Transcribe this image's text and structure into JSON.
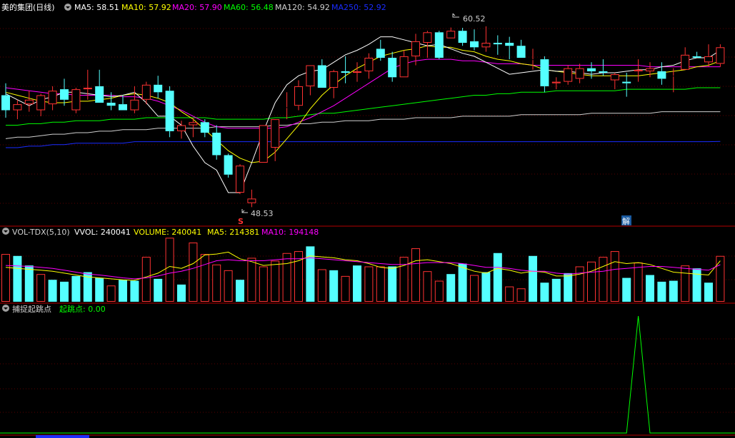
{
  "colors": {
    "bg": "#000000",
    "up": "#ff3232",
    "down": "#54ffff",
    "grid": "#5a0000",
    "divider": "#b40000",
    "ma5": "#ffffff",
    "ma10": "#ffff00",
    "ma20": "#ff00ff",
    "ma60": "#00ff00",
    "ma120": "#d0d0d0",
    "ma250": "#1a2cff",
    "signal": "#00ff00"
  },
  "main_panel": {
    "title": "美的集团(日线)",
    "ma5_label": "MA5: 58.51",
    "ma10_label": "MA10: 57.92",
    "ma20_label": "MA20: 57.90",
    "ma60_label": "MA60: 56.48",
    "ma120_label": "MA120: 54.92",
    "ma250_label": "MA250: 52.92",
    "high_marker": "60.52",
    "low_marker": "48.53",
    "s_marker": "S",
    "jie_marker": "解"
  },
  "volume_panel": {
    "title": "VOL-TDX(5,10)",
    "vvol_label": "VVOL: 240041",
    "volume_label": "VOLUME: 240041",
    "ma5_label": "MA5: 214381",
    "ma10_label": "MA10: 194148"
  },
  "signal_panel": {
    "title": "捕捉起跳点",
    "value_label": "起跳点: 0.00"
  },
  "chart_data": [
    {
      "type": "candlestick",
      "title": "美的集团(日线)",
      "ylim": [
        47.5,
        61.5
      ],
      "ohlc": [
        [
          56.0,
          56.8,
          54.5,
          55.0
        ],
        [
          55.0,
          55.7,
          54.4,
          55.4
        ],
        [
          55.4,
          56.3,
          54.9,
          55.7
        ],
        [
          55.0,
          56.1,
          54.6,
          56.0
        ],
        [
          55.4,
          56.6,
          55.0,
          56.3
        ],
        [
          56.4,
          57.1,
          55.3,
          55.7
        ],
        [
          55.0,
          56.5,
          54.8,
          56.4
        ],
        [
          56.4,
          57.7,
          55.7,
          56.5
        ],
        [
          56.6,
          57.7,
          55.6,
          55.5
        ],
        [
          55.5,
          56.2,
          55.0,
          55.3
        ],
        [
          55.4,
          56.0,
          55.0,
          55.0
        ],
        [
          55.0,
          56.6,
          54.8,
          55.7
        ],
        [
          55.7,
          56.9,
          55.4,
          56.7
        ],
        [
          56.7,
          57.3,
          55.8,
          56.2
        ],
        [
          56.3,
          56.6,
          53.2,
          53.6
        ],
        [
          53.6,
          54.3,
          53.1,
          54.0
        ],
        [
          54.0,
          54.5,
          53.2,
          54.2
        ],
        [
          54.2,
          54.4,
          53.2,
          53.5
        ],
        [
          53.5,
          54.0,
          51.7,
          52.0
        ],
        [
          52.0,
          52.1,
          50.5,
          50.7
        ],
        [
          49.5,
          51.4,
          49.4,
          51.3
        ],
        [
          48.8,
          49.7,
          48.53,
          49.1
        ],
        [
          51.5,
          54.0,
          51.5,
          54.0
        ],
        [
          52.5,
          54.3,
          51.6,
          54.4
        ],
        [
          55.2,
          56.2,
          54.4,
          55.2
        ],
        [
          55.3,
          57.0,
          55.0,
          56.6
        ],
        [
          56.6,
          57.6,
          56.0,
          58.0
        ],
        [
          58.0,
          58.4,
          56.6,
          56.5
        ],
        [
          56.5,
          57.7,
          55.8,
          57.6
        ],
        [
          57.6,
          58.6,
          56.8,
          57.5
        ],
        [
          57.5,
          58.2,
          56.9,
          57.6
        ],
        [
          57.6,
          58.8,
          57.1,
          58.5
        ],
        [
          59.1,
          59.7,
          58.3,
          58.5
        ],
        [
          58.5,
          58.9,
          56.9,
          57.2
        ],
        [
          57.2,
          59.0,
          57.2,
          58.6
        ],
        [
          58.6,
          60.1,
          58.0,
          59.6
        ],
        [
          59.5,
          60.3,
          58.5,
          60.2
        ],
        [
          60.2,
          60.3,
          58.4,
          58.5
        ],
        [
          59.8,
          60.52,
          59.8,
          60.3
        ],
        [
          60.3,
          60.5,
          59.3,
          59.5
        ],
        [
          59.6,
          60.4,
          59.0,
          59.2
        ],
        [
          59.2,
          60.6,
          58.9,
          59.5
        ],
        [
          59.5,
          60.0,
          58.7,
          59.4
        ],
        [
          59.5,
          59.9,
          58.4,
          59.3
        ],
        [
          59.3,
          59.7,
          58.6,
          58.5
        ],
        [
          58.4,
          59.1,
          57.7,
          58.4
        ],
        [
          58.4,
          58.6,
          56.2,
          56.6
        ],
        [
          56.8,
          57.2,
          56.4,
          56.9
        ],
        [
          56.9,
          58.0,
          56.7,
          57.8
        ],
        [
          57.1,
          58.1,
          56.8,
          57.8
        ],
        [
          57.8,
          58.2,
          57.1,
          57.6
        ],
        [
          57.6,
          58.4,
          57.3,
          57.5
        ],
        [
          57.0,
          57.5,
          56.4,
          57.4
        ],
        [
          56.9,
          57.5,
          55.9,
          56.8
        ],
        [
          57.6,
          58.4,
          56.9,
          57.7
        ],
        [
          57.6,
          58.2,
          57.2,
          57.8
        ],
        [
          57.6,
          58.2,
          56.7,
          57.1
        ],
        [
          57.3,
          57.8,
          56.2,
          57.3
        ],
        [
          57.7,
          59.2,
          57.7,
          58.7
        ],
        [
          58.6,
          58.9,
          58.5,
          58.5
        ],
        [
          58.2,
          59.4,
          57.9,
          58.6
        ],
        [
          58.1,
          59.4,
          57.9,
          59.2
        ]
      ],
      "series": [
        {
          "name": "MA5",
          "values": [
            56.1,
            55.7,
            55.3,
            55.7,
            55.9,
            56.2,
            56.2,
            56.1,
            56.0,
            55.9,
            56.0,
            56.2,
            55.5,
            54.6,
            54.6,
            54.0,
            52.6,
            51.5,
            51.0,
            49.5,
            49.5,
            51.5,
            53.6,
            55.5,
            56.7,
            57.3,
            57.6,
            57.7,
            58.2,
            58.7,
            59.0,
            59.4,
            59.9,
            59.9,
            59.7,
            59.5,
            59.3,
            59.4,
            59.1,
            58.8,
            58.6,
            58.2,
            57.8,
            57.4,
            57.5,
            57.6,
            57.7,
            57.6,
            57.6,
            57.5,
            57.4,
            57.5,
            57.5,
            57.6,
            57.7,
            57.7,
            57.9,
            58.0,
            58.3,
            58.5,
            58.5,
            59.0
          ]
        },
        {
          "name": "MA10",
          "values": [
            56.2,
            56.0,
            55.8,
            55.6,
            55.5,
            55.5,
            55.6,
            55.6,
            55.7,
            55.8,
            56.0,
            56.1,
            56.0,
            55.8,
            55.5,
            54.9,
            54.4,
            53.7,
            53.0,
            52.3,
            51.8,
            51.5,
            51.6,
            52.2,
            53.1,
            54.0,
            55.1,
            56.0,
            56.7,
            57.3,
            57.8,
            58.2,
            58.6,
            58.8,
            59.0,
            59.1,
            59.3,
            59.2,
            59.2,
            59.0,
            58.9,
            58.6,
            58.4,
            58.3,
            58.1,
            58.0,
            57.7,
            57.6,
            57.5,
            57.4,
            57.3,
            57.3,
            57.3,
            57.3,
            57.3,
            57.4,
            57.5,
            57.6,
            57.7,
            57.9,
            58.0,
            58.3
          ]
        },
        {
          "name": "MA20",
          "values": [
            56.5,
            56.4,
            56.3,
            56.2,
            56.1,
            56.1,
            56.0,
            56.0,
            56.0,
            56.0,
            55.9,
            55.9,
            55.8,
            55.6,
            55.3,
            55.0,
            54.6,
            54.2,
            53.9,
            53.8,
            53.8,
            53.8,
            53.8,
            53.8,
            53.9,
            54.2,
            54.5,
            54.9,
            55.3,
            55.8,
            56.3,
            56.8,
            57.3,
            57.8,
            58.1,
            58.3,
            58.4,
            58.4,
            58.4,
            58.3,
            58.3,
            58.2,
            58.1,
            58.1,
            58.1,
            58.0,
            58.0,
            58.0,
            58.0,
            58.0,
            58.0,
            58.0,
            58.0,
            58.0,
            58.0,
            57.9,
            57.9,
            57.9,
            57.9,
            57.9,
            57.9,
            57.9
          ]
        },
        {
          "name": "MA60",
          "values": [
            54.0,
            54.0,
            54.1,
            54.1,
            54.2,
            54.2,
            54.3,
            54.3,
            54.3,
            54.4,
            54.4,
            54.4,
            54.5,
            54.5,
            54.5,
            54.5,
            54.5,
            54.5,
            54.4,
            54.4,
            54.4,
            54.4,
            54.4,
            54.5,
            54.5,
            54.6,
            54.7,
            54.8,
            54.8,
            54.9,
            55.0,
            55.1,
            55.2,
            55.3,
            55.4,
            55.5,
            55.6,
            55.7,
            55.8,
            55.9,
            56.0,
            56.0,
            56.1,
            56.1,
            56.2,
            56.2,
            56.2,
            56.3,
            56.3,
            56.3,
            56.3,
            56.3,
            56.3,
            56.4,
            56.4,
            56.4,
            56.4,
            56.4,
            56.4,
            56.5,
            56.5,
            56.5
          ]
        },
        {
          "name": "MA120",
          "values": [
            53.1,
            53.2,
            53.2,
            53.3,
            53.4,
            53.4,
            53.5,
            53.5,
            53.6,
            53.6,
            53.7,
            53.7,
            53.7,
            53.8,
            53.8,
            53.8,
            53.8,
            53.8,
            53.9,
            53.9,
            53.9,
            53.9,
            53.9,
            54.0,
            54.0,
            54.1,
            54.1,
            54.2,
            54.2,
            54.3,
            54.3,
            54.3,
            54.4,
            54.4,
            54.4,
            54.5,
            54.5,
            54.5,
            54.5,
            54.6,
            54.6,
            54.6,
            54.6,
            54.6,
            54.7,
            54.7,
            54.7,
            54.7,
            54.7,
            54.7,
            54.8,
            54.8,
            54.8,
            54.8,
            54.8,
            54.8,
            54.9,
            54.9,
            54.9,
            54.9,
            54.9,
            54.9
          ]
        },
        {
          "name": "MA250",
          "values": [
            52.5,
            52.5,
            52.6,
            52.6,
            52.7,
            52.7,
            52.8,
            52.8,
            52.8,
            52.8,
            52.8,
            52.9,
            52.9,
            52.9,
            52.9,
            52.9,
            52.9,
            52.9,
            52.9,
            52.9,
            52.9,
            52.9,
            52.9,
            52.9,
            52.9,
            52.9,
            52.9,
            52.9,
            52.9,
            52.9,
            52.9,
            52.9,
            52.9,
            52.9,
            52.9,
            52.9,
            52.9,
            52.9,
            52.9,
            52.9,
            52.9,
            52.9,
            52.9,
            52.9,
            52.9,
            52.9,
            52.9,
            52.9,
            52.9,
            52.9,
            52.9,
            52.9,
            52.9,
            52.9,
            52.9,
            52.9,
            52.9,
            52.9,
            52.9,
            52.9,
            52.9,
            52.92
          ]
        }
      ]
    },
    {
      "type": "bar",
      "title": "VOL-TDX(5,10)",
      "ylim": [
        0,
        340000
      ],
      "values": [
        250000,
        240000,
        190000,
        145000,
        115000,
        105000,
        135000,
        155000,
        125000,
        85000,
        115000,
        110000,
        235000,
        120000,
        335000,
        90000,
        310000,
        250000,
        195000,
        165000,
        115000,
        230000,
        185000,
        215000,
        255000,
        265000,
        290000,
        170000,
        165000,
        135000,
        190000,
        185000,
        185000,
        185000,
        235000,
        280000,
        160000,
        110000,
        145000,
        200000,
        140000,
        155000,
        255000,
        80000,
        70000,
        240000,
        100000,
        120000,
        150000,
        185000,
        210000,
        235000,
        265000,
        125000,
        205000,
        140000,
        105000,
        110000,
        190000,
        175000,
        100000,
        240041
      ],
      "up": [
        1,
        0,
        0,
        1,
        0,
        0,
        0,
        0,
        0,
        1,
        0,
        0,
        1,
        0,
        1,
        0,
        1,
        1,
        1,
        1,
        0,
        1,
        1,
        1,
        1,
        1,
        0,
        1,
        0,
        1,
        0,
        1,
        1,
        0,
        1,
        1,
        1,
        1,
        0,
        0,
        1,
        0,
        0,
        1,
        1,
        0,
        0,
        0,
        0,
        1,
        1,
        1,
        1,
        0,
        1,
        0,
        0,
        0,
        1,
        0,
        0,
        1
      ],
      "series": [
        {
          "name": "MA5",
          "values": [
            180000,
            175000,
            170000,
            165000,
            160000,
            150000,
            140000,
            130000,
            125000,
            120000,
            115000,
            112000,
            130000,
            150000,
            185000,
            175000,
            200000,
            245000,
            250000,
            260000,
            225000,
            210000,
            190000,
            195000,
            200000,
            215000,
            240000,
            235000,
            230000,
            220000,
            215000,
            200000,
            180000,
            175000,
            190000,
            215000,
            220000,
            210000,
            200000,
            180000,
            160000,
            150000,
            175000,
            165000,
            150000,
            160000,
            155000,
            135000,
            135000,
            145000,
            160000,
            185000,
            210000,
            200000,
            205000,
            195000,
            175000,
            155000,
            150000,
            145000,
            140000,
            214381
          ]
        },
        {
          "name": "MA10",
          "values": [
            190000,
            188000,
            185000,
            180000,
            175000,
            165000,
            155000,
            145000,
            140000,
            133000,
            125000,
            120000,
            125000,
            135000,
            150000,
            160000,
            175000,
            195000,
            215000,
            220000,
            215000,
            215000,
            215000,
            220000,
            225000,
            225000,
            230000,
            225000,
            220000,
            215000,
            210000,
            205000,
            200000,
            195000,
            195000,
            200000,
            205000,
            205000,
            205000,
            200000,
            190000,
            180000,
            180000,
            175000,
            165000,
            160000,
            160000,
            150000,
            145000,
            150000,
            155000,
            160000,
            170000,
            175000,
            180000,
            185000,
            185000,
            180000,
            175000,
            170000,
            165000,
            194148
          ]
        }
      ]
    },
    {
      "type": "line",
      "title": "捕捉起跳点",
      "ylim": [
        0,
        1
      ],
      "series": [
        {
          "name": "起跳点",
          "values": [
            0,
            0,
            0,
            0,
            0,
            0,
            0,
            0,
            0,
            0,
            0,
            0,
            0,
            0,
            0,
            0,
            0,
            0,
            0,
            0,
            0,
            0,
            0,
            0,
            0,
            0,
            0,
            0,
            0,
            0,
            0,
            0,
            0,
            0,
            0,
            0,
            0,
            0,
            0,
            0,
            0,
            0,
            0,
            0,
            0,
            0,
            0,
            0,
            0,
            0,
            0,
            0,
            0,
            0,
            1,
            0,
            0,
            0,
            0,
            0,
            0,
            0
          ]
        }
      ]
    }
  ]
}
